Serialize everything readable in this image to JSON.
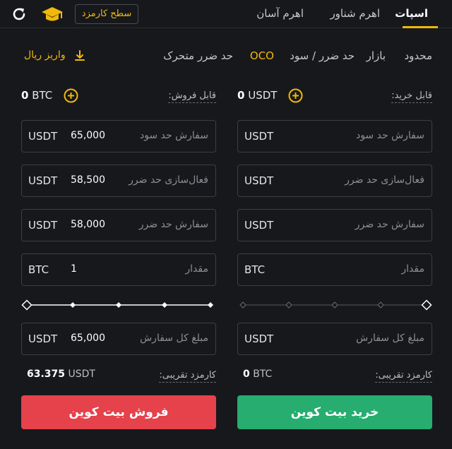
{
  "header": {
    "tabs": [
      {
        "label": "اسپات",
        "active": true
      },
      {
        "label": "اهرم شناور",
        "active": false
      },
      {
        "label": "اهرم آسان",
        "active": false
      }
    ],
    "fee_level_label": "سطح کارمزد",
    "icons": [
      "refresh-icon",
      "graduation-cap-icon"
    ]
  },
  "order_types": {
    "items": [
      "محدود",
      "بازار",
      "حد ضرر / سود",
      "OCO",
      "حد ضرر متحرک"
    ],
    "active": "OCO",
    "deposit_label": "واریز ریال"
  },
  "buy": {
    "available_label": "قابل خرید:",
    "balance_value": "0",
    "balance_unit": "USDT",
    "take_profit": {
      "placeholder": "سفارش حد سود",
      "value": "",
      "unit": "USDT"
    },
    "stop_trigger": {
      "placeholder": "فعال‌سازی حد ضرر",
      "value": "",
      "unit": "USDT"
    },
    "stop_order": {
      "placeholder": "سفارش حد ضرر",
      "value": "",
      "unit": "USDT"
    },
    "amount": {
      "placeholder": "مقدار",
      "value": "",
      "unit": "BTC"
    },
    "slider_fraction": 0,
    "total": {
      "placeholder": "مبلغ کل سفارش",
      "value": "",
      "unit": "USDT"
    },
    "fee_label": "کارمزد تقریبی:",
    "fee_value": "0",
    "fee_unit": "BTC",
    "button_label": "خرید بیت کوین"
  },
  "sell": {
    "available_label": "قابل فروش:",
    "balance_value": "0",
    "balance_unit": "BTC",
    "take_profit": {
      "placeholder": "سفارش حد سود",
      "value": "65,000",
      "unit": "USDT"
    },
    "stop_trigger": {
      "placeholder": "فعال‌سازی حد ضرر",
      "value": "58,500",
      "unit": "USDT"
    },
    "stop_order": {
      "placeholder": "سفارش حد ضرر",
      "value": "58,000",
      "unit": "USDT"
    },
    "amount": {
      "placeholder": "مقدار",
      "value": "1",
      "unit": "BTC"
    },
    "slider_fraction": 1,
    "total": {
      "placeholder": "مبلغ کل سفارش",
      "value": "65,000",
      "unit": "USDT"
    },
    "fee_label": "کارمزد تقریبی:",
    "fee_value": "63.375",
    "fee_unit": "USDT",
    "button_label": "فروش بیت کوین"
  },
  "colors": {
    "accent": "#f0b90b",
    "buy": "#26ad6f",
    "sell": "#e5424c",
    "background": "#17181c"
  }
}
